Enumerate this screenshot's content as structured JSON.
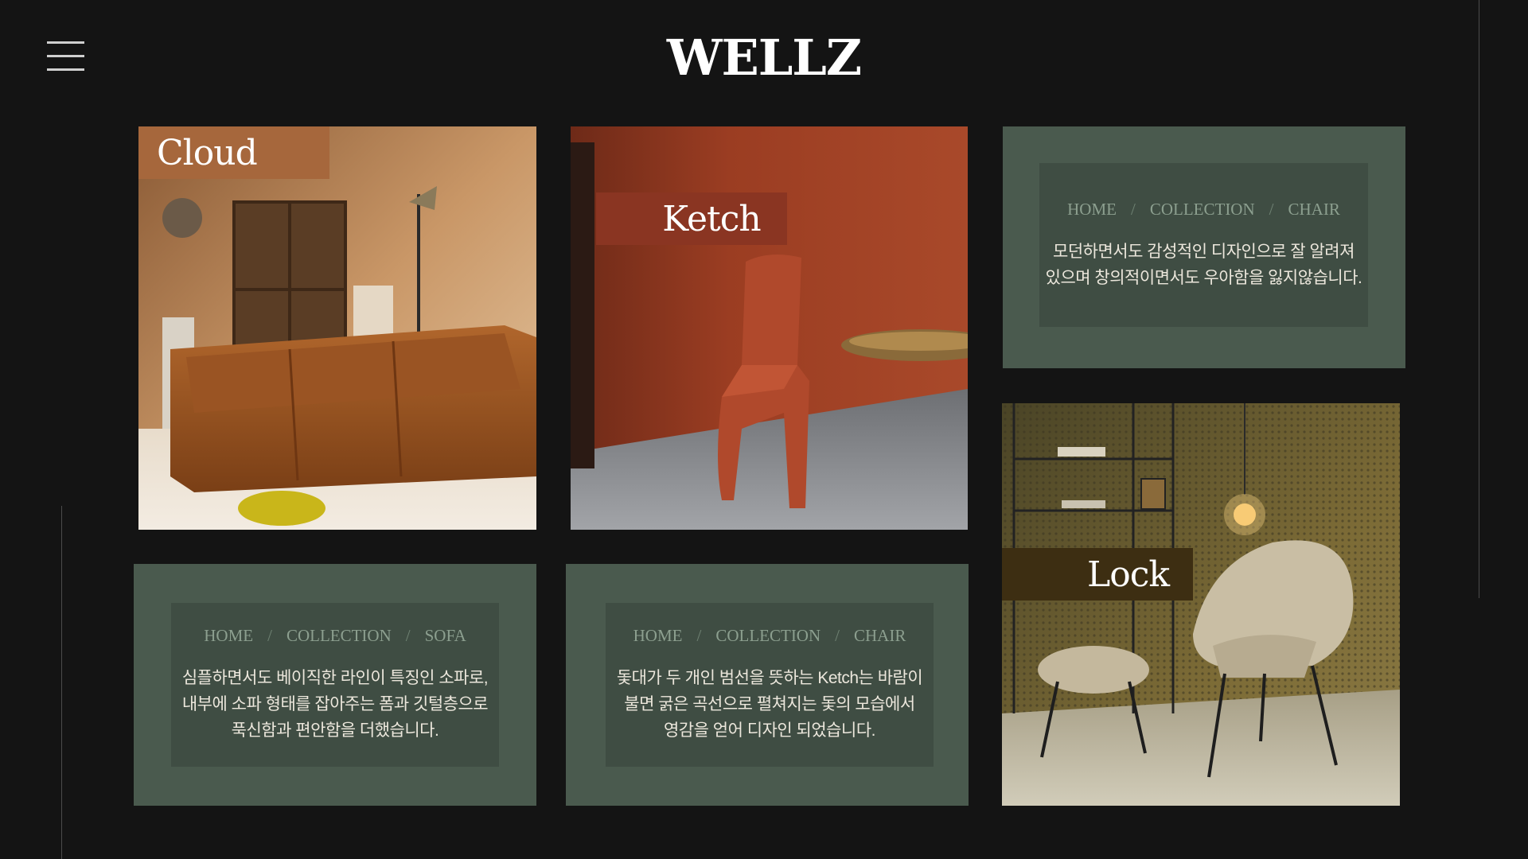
{
  "header": {
    "logo": "WELLZ",
    "menu_icon": "hamburger-menu-icon"
  },
  "products": [
    {
      "name": "Cloud",
      "category": "SOFA"
    },
    {
      "name": "Ketch",
      "category": "CHAIR"
    },
    {
      "name": "Lock",
      "category": "CHAIR"
    }
  ],
  "info_cards": [
    {
      "breadcrumb": [
        "HOME",
        "COLLECTION",
        "CHAIR"
      ],
      "description": [
        "모던하면서도 감성적인 디자인으로 잘 알려져",
        "있으며 창의적이면서도 우아함을 잃지않습니다."
      ]
    },
    {
      "breadcrumb": [
        "HOME",
        "COLLECTION",
        "SOFA"
      ],
      "description": [
        "심플하면서도 베이직한 라인이 특징인 소파로,",
        "내부에 소파 형태를 잡아주는 폼과 깃털층으로",
        "푹신함과 편안함을 더했습니다."
      ]
    },
    {
      "breadcrumb": [
        "HOME",
        "COLLECTION",
        "CHAIR"
      ],
      "description": [
        "돛대가 두 개인 범선을 뜻하는 Ketch는 바람이",
        "불면 굵은 곡선으로 펼쳐지는 돛의 모습에서",
        "영감을 얻어 디자인 되었습니다."
      ]
    }
  ],
  "breadcrumb_separator": "/",
  "colors": {
    "background": "#141414",
    "info_outer": "#4a5a4e",
    "info_inner": "#3f4d43",
    "cloud_label": "#a6673c",
    "ketch_label": "#8a3522",
    "lock_label": "#3d2e12"
  }
}
